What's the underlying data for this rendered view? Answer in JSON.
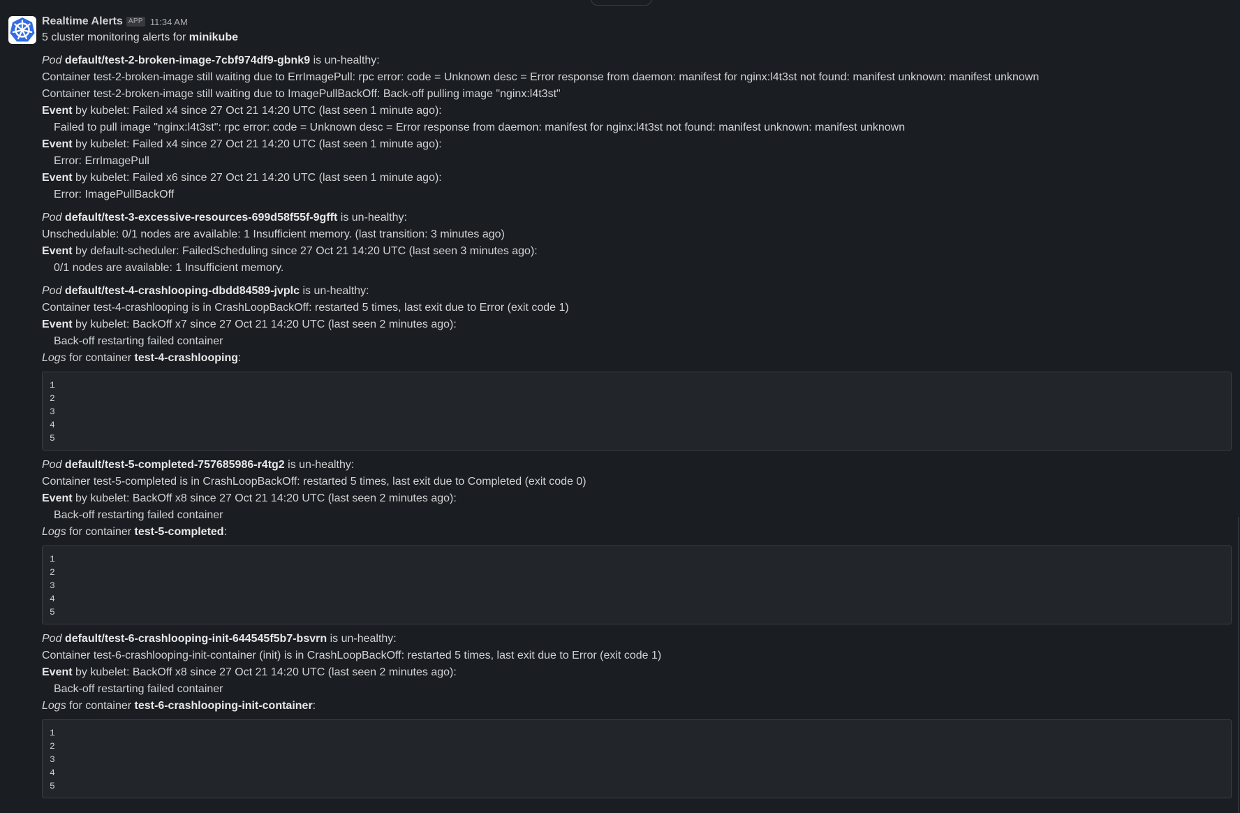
{
  "message": {
    "sender": "Realtime Alerts",
    "badge": "APP",
    "time": "11:34 AM",
    "summary_prefix": "5 cluster monitoring alerts for",
    "cluster": "minikube"
  },
  "labels": {
    "pod": "Pod",
    "unhealthy": "is un-healthy:",
    "event": "Event",
    "logs": "Logs",
    "for_container": "for container",
    "colon": ":"
  },
  "pods": [
    {
      "name": "default/test-2-broken-image-7cbf974df9-gbnk9",
      "lines": [
        "Container test-2-broken-image still waiting due to ErrImagePull: rpc error: code = Unknown desc = Error response from daemon: manifest for nginx:l4t3st not found: manifest unknown: manifest unknown",
        "Container test-2-broken-image still waiting due to ImagePullBackOff: Back-off pulling image \"nginx:l4t3st\""
      ],
      "events": [
        {
          "text": "by kubelet: Failed x4 since 27 Oct 21 14:20 UTC (last seen 1 minute ago):",
          "detail": "Failed to pull image \"nginx:l4t3st\": rpc error: code = Unknown desc = Error response from daemon: manifest for nginx:l4t3st not found: manifest unknown: manifest unknown"
        },
        {
          "text": "by kubelet: Failed x4 since 27 Oct 21 14:20 UTC (last seen 1 minute ago):",
          "detail": "Error: ErrImagePull"
        },
        {
          "text": "by kubelet: Failed x6 since 27 Oct 21 14:20 UTC (last seen 1 minute ago):",
          "detail": "Error: ImagePullBackOff"
        }
      ]
    },
    {
      "name": "default/test-3-excessive-resources-699d58f55f-9gfft",
      "lines": [
        "Unschedulable: 0/1 nodes are available: 1 Insufficient memory. (last transition: 3 minutes ago)"
      ],
      "events": [
        {
          "text": "by default-scheduler: FailedScheduling since 27 Oct 21 14:20 UTC (last seen 3 minutes ago):",
          "detail": "0/1 nodes are available: 1 Insufficient memory."
        }
      ]
    },
    {
      "name": "default/test-4-crashlooping-dbdd84589-jvplc",
      "lines": [
        "Container test-4-crashlooping is in CrashLoopBackOff: restarted 5 times, last exit due to Error (exit code 1)"
      ],
      "events": [
        {
          "text": "by kubelet: BackOff x7 since 27 Oct 21 14:20 UTC (last seen 2 minutes ago):",
          "detail": "Back-off restarting failed container"
        }
      ],
      "logs_container": "test-4-crashlooping",
      "logs": [
        "1",
        "2",
        "3",
        "4",
        "5"
      ]
    },
    {
      "name": "default/test-5-completed-757685986-r4tg2",
      "lines": [
        "Container test-5-completed is in CrashLoopBackOff: restarted 5 times, last exit due to Completed (exit code 0)"
      ],
      "events": [
        {
          "text": "by kubelet: BackOff x8 since 27 Oct 21 14:20 UTC (last seen 2 minutes ago):",
          "detail": "Back-off restarting failed container"
        }
      ],
      "logs_container": "test-5-completed",
      "logs": [
        "1",
        "2",
        "3",
        "4",
        "5"
      ]
    },
    {
      "name": "default/test-6-crashlooping-init-644545f5b7-bsvrn",
      "lines": [
        "Container test-6-crashlooping-init-container (init) is in CrashLoopBackOff: restarted 5 times, last exit due to Error (exit code 1)"
      ],
      "events": [
        {
          "text": "by kubelet: BackOff x8 since 27 Oct 21 14:20 UTC (last seen 2 minutes ago):",
          "detail": "Back-off restarting failed container"
        }
      ],
      "logs_container": "test-6-crashlooping-init-container",
      "logs": [
        "1",
        "2",
        "3",
        "4",
        "5"
      ]
    }
  ],
  "colors": {
    "background": "#1a1d21",
    "text": "#d1d2d3",
    "muted": "#a9abad",
    "code_bg": "#222529",
    "code_border": "#3b3e43",
    "avatar_accent": "#326ce5"
  },
  "icons": {
    "avatar": "kubernetes-helm-icon"
  }
}
